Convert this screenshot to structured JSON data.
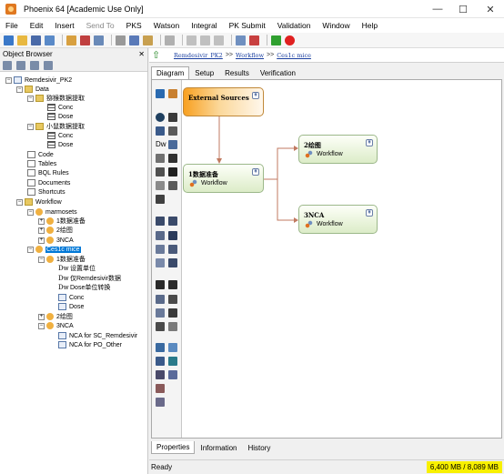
{
  "window": {
    "title": "Phoenix 64 [Academic Use Only]",
    "minimize": "—",
    "maximize": "☐",
    "close": "✕"
  },
  "menu": [
    {
      "label": "File",
      "enabled": true
    },
    {
      "label": "Edit",
      "enabled": true
    },
    {
      "label": "Insert",
      "enabled": true
    },
    {
      "label": "Send To",
      "enabled": false
    },
    {
      "label": "PKS",
      "enabled": true
    },
    {
      "label": "Watson",
      "enabled": true
    },
    {
      "label": "Integral",
      "enabled": true
    },
    {
      "label": "PK Submit",
      "enabled": true
    },
    {
      "label": "Validation",
      "enabled": true
    },
    {
      "label": "Window",
      "enabled": true
    },
    {
      "label": "Help",
      "enabled": true
    }
  ],
  "object_browser": {
    "title": "Object Browser",
    "close": "✕",
    "tree": [
      {
        "label": "Remdesivir_PK2",
        "icon": "project"
      },
      {
        "label": "Data",
        "icon": "folder"
      },
      {
        "label": "猕猴数据提取",
        "icon": "folder"
      },
      {
        "label": "Conc",
        "icon": "table"
      },
      {
        "label": "Dose",
        "icon": "table"
      },
      {
        "label": "小鼠数据提取",
        "icon": "folder"
      },
      {
        "label": "Conc",
        "icon": "table"
      },
      {
        "label": "Dose",
        "icon": "table"
      },
      {
        "label": "Code",
        "icon": "doc"
      },
      {
        "label": "Tables",
        "icon": "doc"
      },
      {
        "label": "BQL Rules",
        "icon": "doc"
      },
      {
        "label": "Documents",
        "icon": "doc"
      },
      {
        "label": "Shortcuts",
        "icon": "doc"
      },
      {
        "label": "Workflow",
        "icon": "folder"
      },
      {
        "label": "marmosets",
        "icon": "workflow"
      },
      {
        "label": "1数据准备",
        "icon": "workflow"
      },
      {
        "label": "2绘图",
        "icon": "workflow"
      },
      {
        "label": "3NCA",
        "icon": "workflow"
      },
      {
        "label": "Ces1c mice",
        "icon": "workflow"
      },
      {
        "label": "1数据准备",
        "icon": "workflow"
      },
      {
        "label": "设置单位",
        "icon": "dw"
      },
      {
        "label": "仅Remdesivir数据",
        "icon": "dw"
      },
      {
        "label": "Dose单位转换",
        "icon": "dw"
      },
      {
        "label": "Conc",
        "icon": "sheet"
      },
      {
        "label": "Dose",
        "icon": "sheet"
      },
      {
        "label": "2绘图",
        "icon": "workflow"
      },
      {
        "label": "3NCA",
        "icon": "workflow"
      },
      {
        "label": "NCA for SC_Remdesivir",
        "icon": "nca"
      },
      {
        "label": "NCA for PO_Other",
        "icon": "nca"
      }
    ]
  },
  "breadcrumb": [
    "Remdesivir_PK2",
    "Workflow",
    "Ces1c mice"
  ],
  "breadcrumb_sep": ">>",
  "tabs": [
    {
      "label": "Diagram",
      "active": true
    },
    {
      "label": "Setup",
      "active": false
    },
    {
      "label": "Results",
      "active": false
    },
    {
      "label": "Verification",
      "active": false
    }
  ],
  "diagram": {
    "source": {
      "title": "External Sources"
    },
    "nodes": [
      {
        "title": "1数据准备",
        "sub": "Workflow"
      },
      {
        "title": "2绘图",
        "sub": "Workflow"
      },
      {
        "title": "3NCA",
        "sub": "Workflow"
      }
    ],
    "chevron": "¥"
  },
  "bottom_tabs": [
    {
      "label": "Properties",
      "active": true
    },
    {
      "label": "Information",
      "active": false
    },
    {
      "label": "History",
      "active": false
    }
  ],
  "status": {
    "text": "Ready",
    "memory": "6,400 MB / 8,089 MB"
  }
}
